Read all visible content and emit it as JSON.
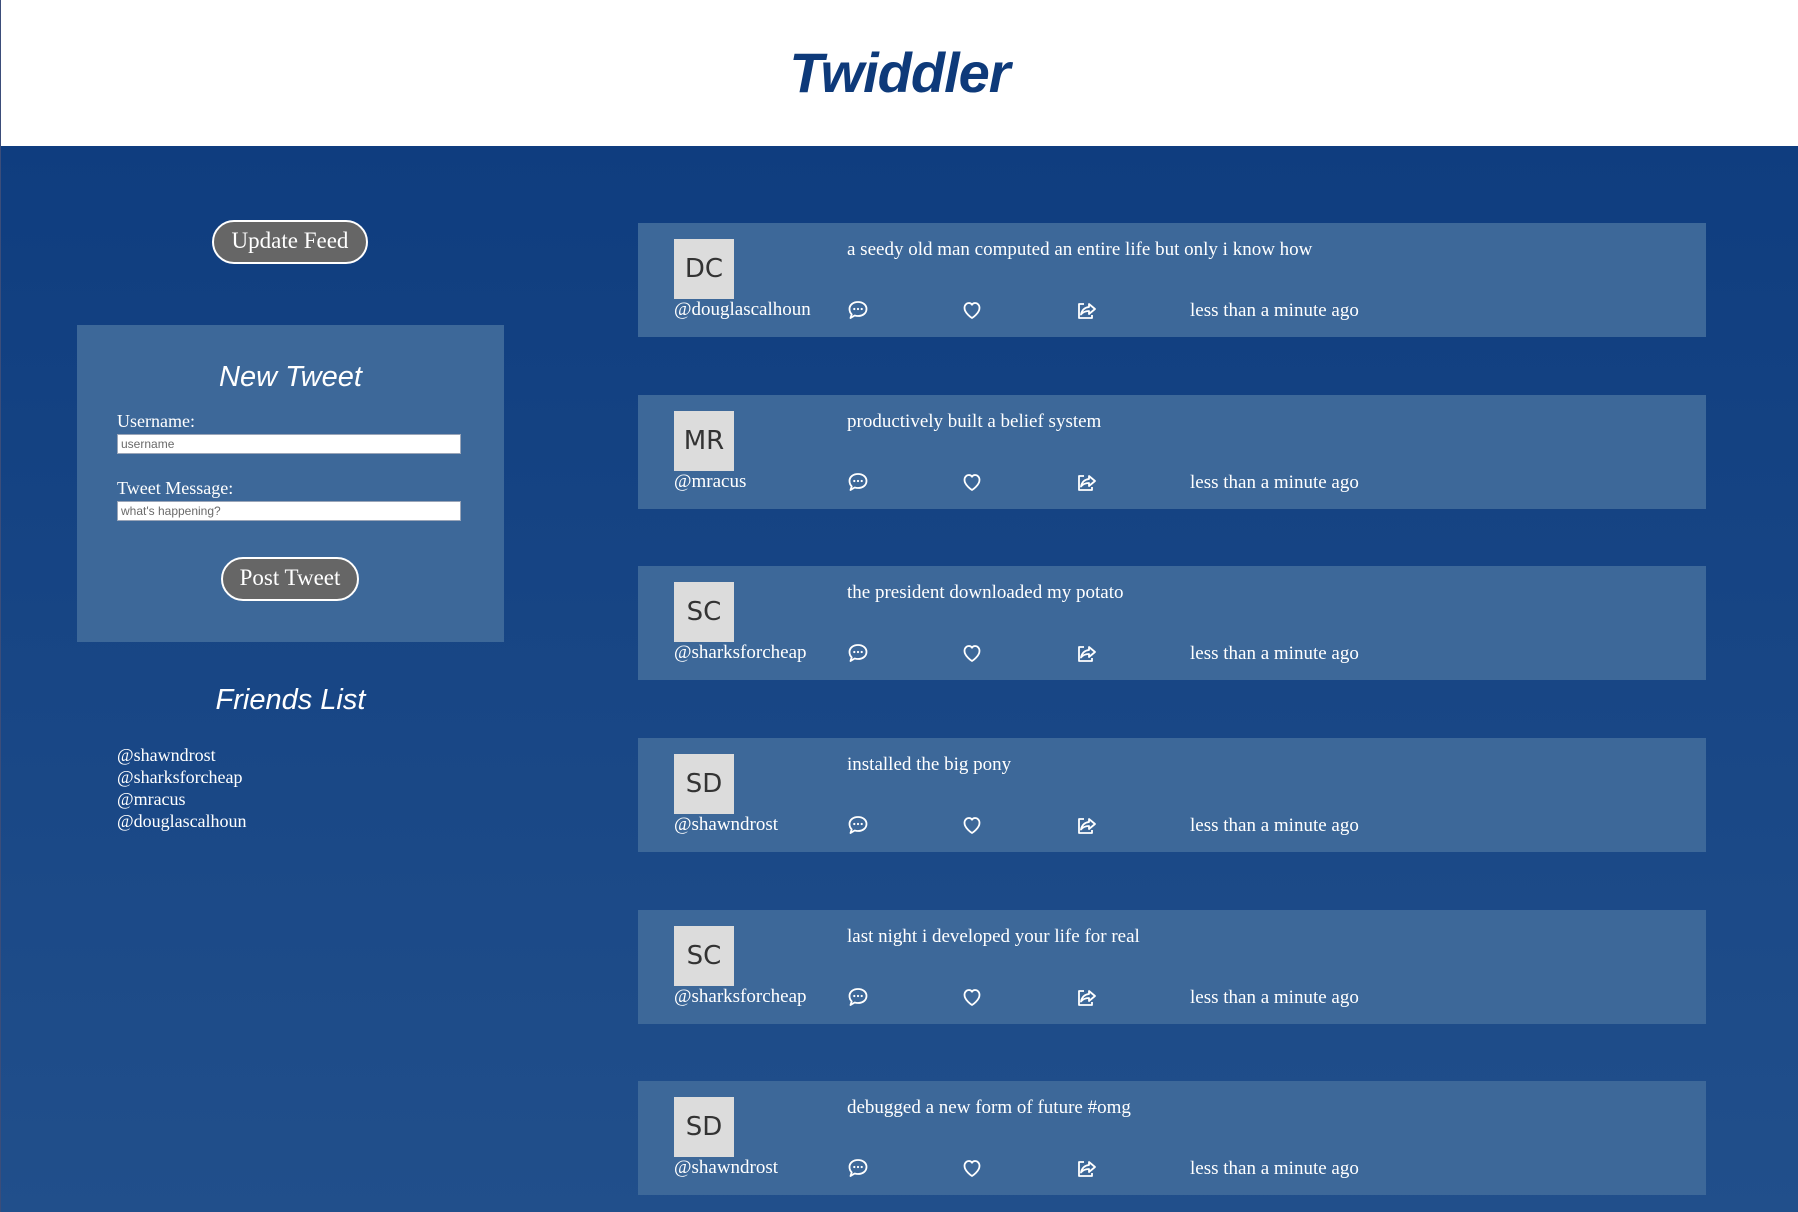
{
  "header": {
    "title": "Twiddler"
  },
  "sidebar": {
    "update_feed_label": "Update Feed",
    "new_tweet": {
      "title": "New Tweet",
      "username_label": "Username:",
      "username_placeholder": "username",
      "message_label": "Tweet Message:",
      "message_placeholder": "what's happening?",
      "post_label": "Post Tweet"
    },
    "friends": {
      "title": "Friends List",
      "items": [
        "@shawndrost",
        "@sharksforcheap",
        "@mracus",
        "@douglascalhoun"
      ]
    }
  },
  "feed": {
    "tweets": [
      {
        "initials": "DC",
        "handle": "@douglascalhoun",
        "message": "a seedy old man computed an entire life but only i know how",
        "time": "less than a minute ago"
      },
      {
        "initials": "MR",
        "handle": "@mracus",
        "message": "productively built a belief system",
        "time": "less than a minute ago"
      },
      {
        "initials": "SC",
        "handle": "@sharksforcheap",
        "message": "the president downloaded my potato",
        "time": "less than a minute ago"
      },
      {
        "initials": "SD",
        "handle": "@shawndrost",
        "message": "installed the big pony",
        "time": "less than a minute ago"
      },
      {
        "initials": "SC",
        "handle": "@sharksforcheap",
        "message": "last night i developed your life for real",
        "time": "less than a minute ago"
      },
      {
        "initials": "SD",
        "handle": "@shawndrost",
        "message": "debugged a new form of future #omg",
        "time": "less than a minute ago"
      }
    ],
    "actions": [
      "comment-icon",
      "heart-icon",
      "share-icon"
    ]
  },
  "colors": {
    "brand": "#0e3a7a",
    "background_top": "#0f3d7f",
    "background_bottom": "#214f8b",
    "card": "#3d6899",
    "button": "#666666"
  }
}
